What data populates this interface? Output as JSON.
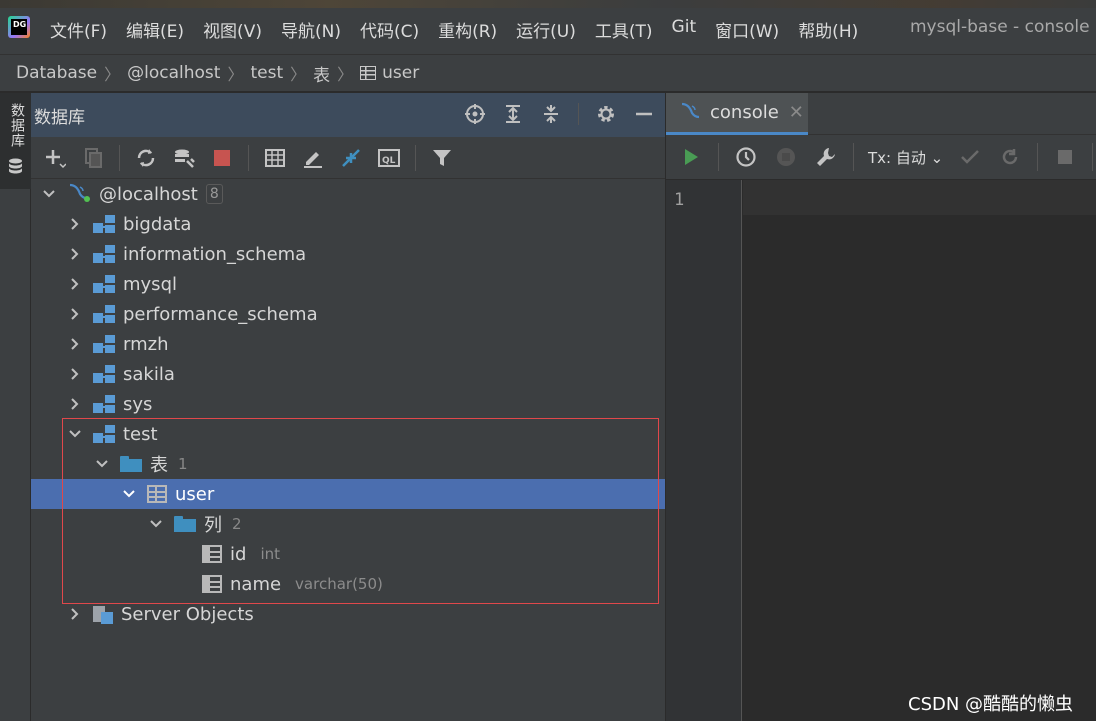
{
  "app": {
    "logo_text": "DG",
    "window_title": "mysql-base - console"
  },
  "menu": [
    "文件(F)",
    "编辑(E)",
    "视图(V)",
    "导航(N)",
    "代码(C)",
    "重构(R)",
    "运行(U)",
    "工具(T)",
    "Git",
    "窗口(W)",
    "帮助(H)"
  ],
  "breadcrumb": {
    "items": [
      "Database",
      "@localhost",
      "test",
      "表",
      "user"
    ]
  },
  "tool_strip": {
    "tab_label": "数据库"
  },
  "db_panel": {
    "title": "数据库",
    "tree": {
      "root": {
        "label": "@localhost",
        "count": "8"
      },
      "schemas": [
        "bigdata",
        "information_schema",
        "mysql",
        "performance_schema",
        "rmzh",
        "sakila",
        "sys"
      ],
      "open_schema": {
        "label": "test"
      },
      "tables_folder": {
        "label": "表",
        "count": "1"
      },
      "table": {
        "label": "user"
      },
      "columns_folder": {
        "label": "列",
        "count": "2"
      },
      "columns": [
        {
          "name": "id",
          "type": "int"
        },
        {
          "name": "name",
          "type": "varchar(50)"
        }
      ],
      "server_objects": {
        "label": "Server Objects"
      }
    }
  },
  "editor": {
    "tab_label": "console",
    "tx_label": "Tx: 自动",
    "line_numbers": [
      "1"
    ]
  },
  "watermark": "CSDN @酷酷的懒虫",
  "colors": {
    "selection": "#4b6eaf",
    "highlight_box": "#e0484b",
    "run_green": "#499c54",
    "stop_red": "#c75450"
  }
}
